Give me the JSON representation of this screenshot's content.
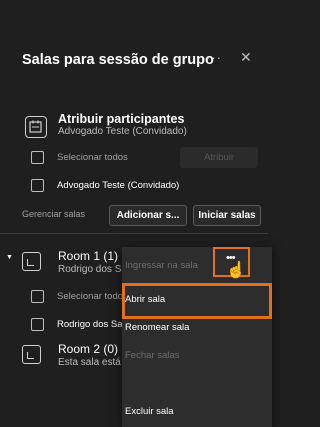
{
  "panel": {
    "title": "Salas para sessão de grupo",
    "more_icon": "more-icon",
    "close_icon": "close-icon"
  },
  "assign": {
    "title": "Atribuir participantes",
    "subtitle": "Advogado Teste (Convidado)",
    "select_all": "Selecionar todos",
    "assign_button": "Atribuir",
    "participant": "Advogado Teste (Convidado)"
  },
  "manage": {
    "label": "Gerenciar salas",
    "add_button": "Adicionar s...",
    "start_button": "Iniciar salas"
  },
  "rooms": [
    {
      "title": "Room 1 (1)",
      "subtitle": "Rodrigo dos Santos Severino",
      "select_all": "Selecionar todo",
      "member": "Rodrigo dos Sa"
    },
    {
      "title": "Room 2 (0)",
      "subtitle": "Esta sala está v"
    }
  ],
  "room_more_icon": "more-horizontal-icon",
  "context_menu": {
    "items": [
      {
        "label": "Ingressar na sala",
        "enabled": false
      },
      {
        "label": "Abrir sala",
        "enabled": true,
        "highlighted": true
      },
      {
        "label": "Renomear sala",
        "enabled": true
      },
      {
        "label": "Fechar salas",
        "enabled": false
      },
      {
        "label": "Excluir sala",
        "enabled": true
      }
    ]
  },
  "colors": {
    "background": "#1f1f1f",
    "menu": "#2d2d2d",
    "highlight_outline": "#e07020",
    "disabled_text": "#6d6d6d"
  }
}
